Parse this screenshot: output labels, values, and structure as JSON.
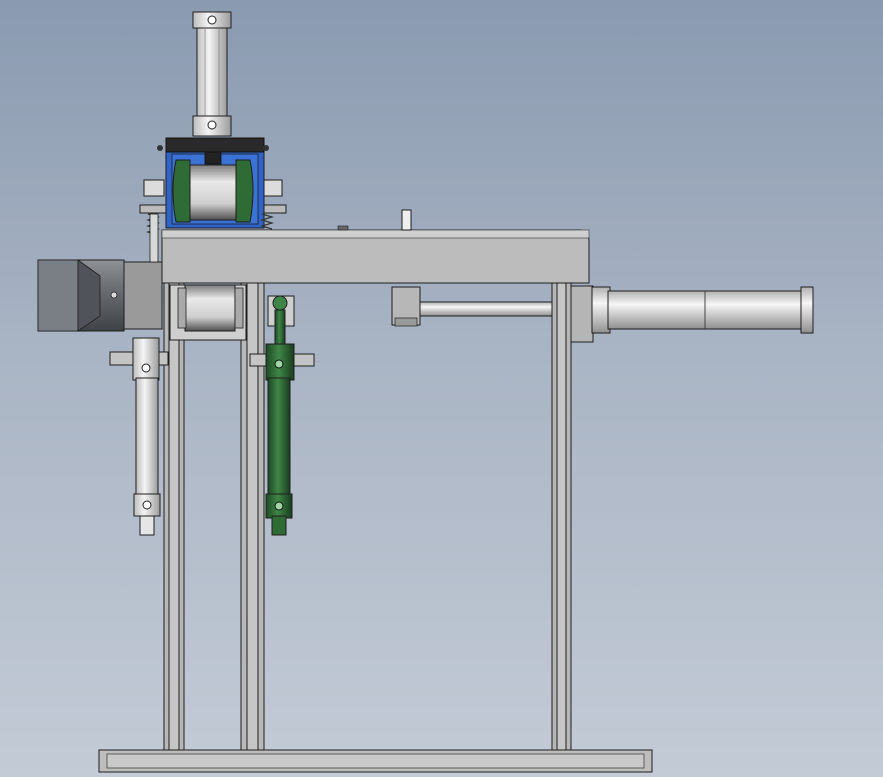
{
  "scene": {
    "background_top": "#8a9ab0",
    "background_bottom": "#c3cbd6",
    "frame_color": "#b8b8b8",
    "steel_color": "#d0d0d0",
    "blue_bracket_color": "#2f63c8",
    "green_cylinder_color": "#2e6b35",
    "motor_color": "#5e6268",
    "outline_color": "#1e1e1e"
  },
  "components": {
    "vertical_cylinder": "pneumatic-cylinder-vertical",
    "horizontal_cylinder": "pneumatic-cylinder-horizontal",
    "left_cylinder": "pneumatic-cylinder-left",
    "green_cylinder": "pneumatic-cylinder-green",
    "motor": "servo-motor",
    "roller_upper": "roller-upper",
    "roller_lower": "roller-lower",
    "bracket": "blue-bracket",
    "springs": "compression-spring",
    "frame": "machine-frame",
    "base": "base-plate"
  }
}
